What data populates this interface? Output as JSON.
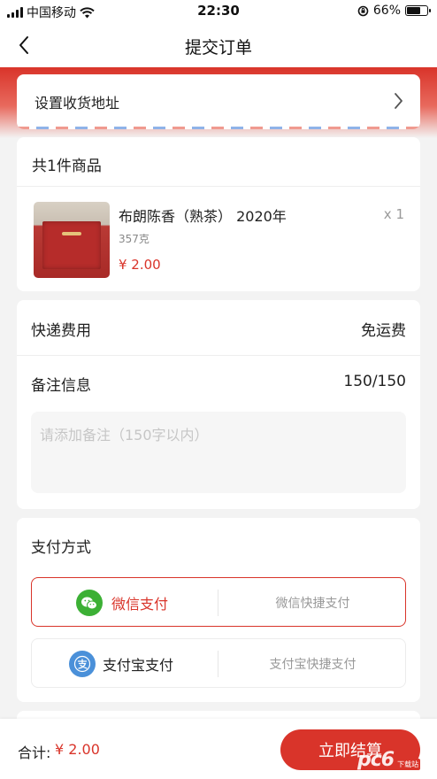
{
  "status_bar": {
    "carrier": "中国移动",
    "time": "22:30",
    "battery": "66%",
    "battery_level": 0.66
  },
  "nav": {
    "title": "提交订单"
  },
  "address": {
    "label": "设置收货地址"
  },
  "goods": {
    "header": "共1件商品",
    "items": [
      {
        "name": "布朗陈香（熟茶） 2020年",
        "spec": "357克",
        "price": "¥ 2.00",
        "qty": "x 1"
      }
    ]
  },
  "shipping": {
    "label": "快递费用",
    "value": "免运费"
  },
  "remark": {
    "label": "备注信息",
    "counter": "150/150",
    "placeholder": "请添加备注（150字以内）"
  },
  "payment": {
    "title": "支付方式",
    "options": [
      {
        "name": "微信支付",
        "desc": "微信快捷支付",
        "selected": true,
        "color": "#3cb035",
        "icon": "wechat-icon"
      },
      {
        "name": "支付宝支付",
        "desc": "支付宝快捷支付",
        "selected": false,
        "color": "#4a90d9",
        "icon": "alipay-icon"
      }
    ]
  },
  "footer": {
    "total_label": "合计:",
    "total_value": "¥ 2.00",
    "checkout_label": "立即结算"
  },
  "watermark": {
    "text": "pc6",
    "sub": "下载站"
  },
  "colors": {
    "accent": "#d9342a"
  }
}
